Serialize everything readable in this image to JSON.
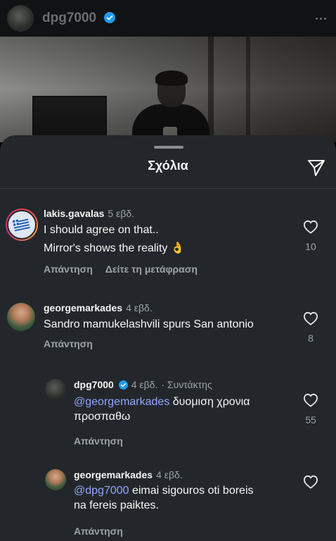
{
  "post": {
    "username": "dpg7000"
  },
  "sheet": {
    "title": "Σχόλια"
  },
  "comments": [
    {
      "username": "lakis.gavalas",
      "time": "5 εβδ.",
      "line1": "I should agree on that..",
      "line2": "Mirror's shows the reality 👌",
      "reply_label": "Απάντηση",
      "translate_label": "Δείτε τη μετάφραση",
      "likes": "10"
    },
    {
      "username": "georgemarkades",
      "time": "4 εβδ.",
      "line1": "Sandro mamukelashvili spurs San antonio",
      "reply_label": "Απάντηση",
      "likes": "8"
    },
    {
      "username": "dpg7000",
      "time": "4 εβδ.",
      "author_tag": "· Συντάκτης",
      "mention": "@georgemarkades",
      "line1_rest": " δυομιση χρονια",
      "line2": "προσπαθω",
      "reply_label": "Απάντηση",
      "likes": "55"
    },
    {
      "username": "georgemarkades",
      "time": "4 εβδ.",
      "mention": "@dpg7000",
      "line1_rest": " eimai sigouros oti boreis",
      "line2": "na fereis paiktes.",
      "reply_label": "Απάντηση"
    }
  ],
  "colors": {
    "sheet_bg": "#23272b",
    "mention": "#8fa6ff",
    "verified": "#1d9bf0",
    "muted": "#9ea3a8"
  },
  "icons": [
    "verified-badge-icon",
    "more-options-icon",
    "share-send-icon",
    "heart-icon"
  ]
}
